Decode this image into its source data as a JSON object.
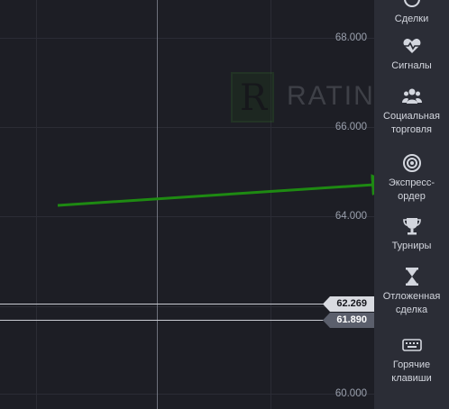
{
  "chart": {
    "price_axis": [
      "68.000",
      "66.000",
      "64.000",
      "60.000"
    ],
    "levels": [
      {
        "price": "62.269",
        "style": "light"
      },
      {
        "price": "61.890",
        "style": "dark"
      }
    ],
    "watermark_text": "RATINGS",
    "watermark_logo_letter": "R"
  },
  "sidebar": {
    "items": [
      {
        "label": "Сделки",
        "icon": "deals-icon"
      },
      {
        "label": "Сигналы",
        "icon": "heartbeat-icon"
      },
      {
        "label": "Социальная торговля",
        "icon": "users-icon"
      },
      {
        "label": "Экспресс-ордер",
        "icon": "target-icon"
      },
      {
        "label": "Турниры",
        "icon": "trophy-icon"
      },
      {
        "label": "Отложенная сделка",
        "icon": "hourglass-icon"
      },
      {
        "label": "Горячие клавиши",
        "icon": "keyboard-icon"
      }
    ]
  },
  "colors": {
    "background": "#1d1e25",
    "sidebar": "#2b2d36",
    "annotation_arrow": "#1e8a12",
    "level_light": "#d9dbe1",
    "level_dark": "#5b5f6c"
  }
}
